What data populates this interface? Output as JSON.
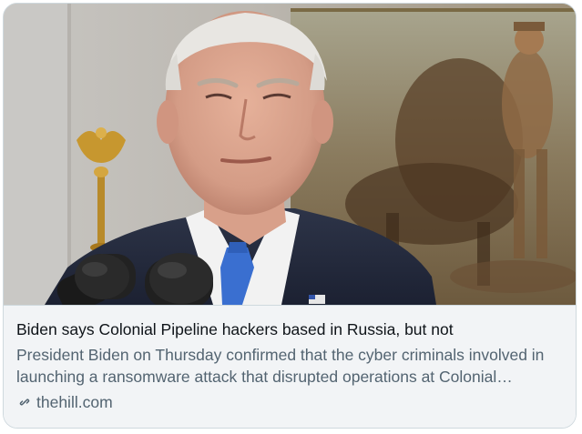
{
  "card": {
    "title": "Biden says Colonial Pipeline hackers based in Russia, but not",
    "description": "President Biden on Thursday confirmed that the cyber criminals involved in launching a ransomware attack that disrupted operations at Colonial…",
    "domain": "thehill.com",
    "link_icon": "link-icon",
    "media_description_icon": "photo"
  },
  "colors": {
    "border": "#cfd9de",
    "meta_background": "#f2f4f6",
    "title_text": "#0f1419",
    "secondary_text": "#536471"
  }
}
